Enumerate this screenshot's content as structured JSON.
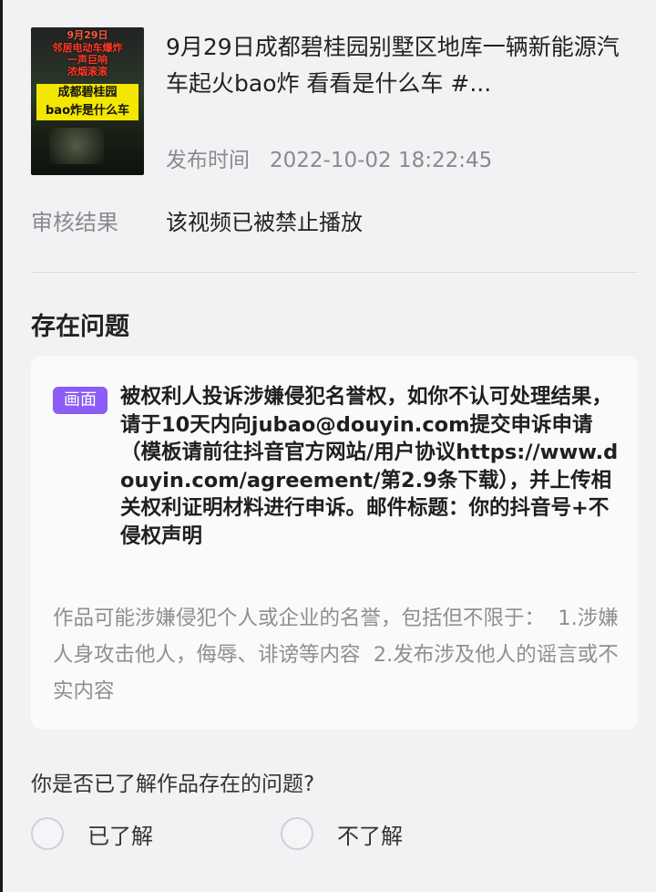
{
  "video": {
    "thumbnail_caption_top": "9月29日",
    "thumbnail_caption_mid": "邻居电动车爆炸\n一声巨响\n浓烟滚滚",
    "thumbnail_banner": "成都碧桂园\nbao炸是什么车",
    "title": "9月29日成都碧桂园别墅区地库一辆新能源汽车起火bao炸 看看是什么车 #...",
    "publish_label": "发布时间",
    "publish_time": "2022-10-02 18:22:45"
  },
  "review": {
    "label": "审核结果",
    "value": "该视频已被禁止播放"
  },
  "issues": {
    "section_title": "存在问题",
    "tag": "画面",
    "text": "被权利人投诉涉嫌侵犯名誉权，如你不认可处理结果，请于10天内向jubao@douyin.com提交申诉申请（模板请前往抖音官方网站/用户协议https://www.douyin.com/agreement/第2.9条下载），并上传相关权利证明材料进行申诉。邮件标题：你的抖音号+不侵权声明",
    "description": "作品可能涉嫌侵犯个人或企业的名誉，包括但不限于：  1.涉嫌人身攻击他人，侮辱、诽谤等内容  2.发布涉及他人的谣言或不实内容"
  },
  "question": {
    "text": "你是否已了解作品存在的问题?",
    "option_yes": "已了解",
    "option_no": "不了解"
  },
  "colors": {
    "tag_bg": "#8b5cf6",
    "background": "#f2f2f4",
    "card_bg": "#fafafb"
  }
}
